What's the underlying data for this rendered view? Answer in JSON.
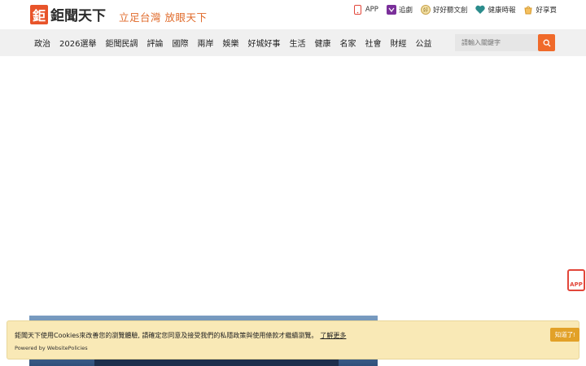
{
  "header": {
    "logo_mark": "鉅",
    "logo_text": "鉅聞天下",
    "slogan": "立足台灣 放眼天下",
    "links": [
      {
        "icon": "phone-icon",
        "label": "APP",
        "color": "#e2463a"
      },
      {
        "icon": "drama-icon",
        "label": "追劇",
        "color": "#7a2f9a"
      },
      {
        "icon": "good-news-icon",
        "label": "好好聽文創",
        "color": "#c8a24a"
      },
      {
        "icon": "health-heart-icon",
        "label": "健康時報",
        "color": "#2b8c8c"
      },
      {
        "icon": "shopping-icon",
        "label": "好享買",
        "color": "#d79a2a"
      }
    ]
  },
  "nav": {
    "items": [
      "政治",
      "2026選舉",
      "鉅聞民調",
      "評論",
      "國際",
      "兩岸",
      "娛樂",
      "好城好事",
      "生活",
      "健康",
      "名家",
      "社會",
      "財經",
      "公益"
    ]
  },
  "search": {
    "placeholder": "請輸入關鍵字",
    "accent": "#f06a2a"
  },
  "floating_app": {
    "label": "APP"
  },
  "cookie_banner": {
    "message": "鉅聞天下使用Cookies來改善您的瀏覽體驗, 請確定您同意及接受我們的私隱政策與使用條款才繼續瀏覽。",
    "link": "了解更多",
    "powered_by": "Powered by WebsitePolicies",
    "accept_button": "知道了!",
    "background": "#f9e9b6"
  }
}
